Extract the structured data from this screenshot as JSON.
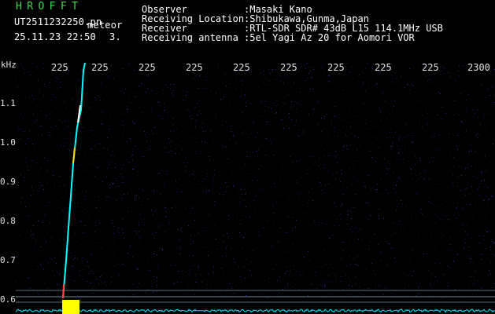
{
  "app_title": "HROFFT",
  "file_name": "UT2511232250.pn",
  "mode": "meteor",
  "timestamp": "25.11.23 22:50",
  "counter": "3.",
  "observer": {
    "label": "Observer",
    "value": ":Masaki Kano"
  },
  "location": {
    "label": "Receiving Location",
    "value": ":Shibukawa,Gunma,Japan"
  },
  "receiver": {
    "label": "Receiver",
    "value": ":RTL-SDR SDR# 43dB L15 114.1MHz USB"
  },
  "antenna": {
    "label": "Receiving antenna",
    "value": ":5el Yagi Az 20 for Aomori VOR"
  },
  "axis": {
    "unit": "kHz",
    "x_ticks": [
      "225",
      "225",
      "225",
      "225",
      "225",
      "225",
      "225",
      "225",
      "225",
      "2300"
    ],
    "y_ticks": [
      "1.1",
      "1.0",
      "0.9",
      "0.8",
      "0.7",
      "0.6"
    ]
  },
  "colors": {
    "title": "#3fd84a",
    "text": "#ffffff",
    "tick": "#e0e0e0",
    "background": "#000000",
    "noise": "#1a1a5e",
    "trace": "#00ffff",
    "spectrum": "#00e5ff",
    "peak": "#ffff00"
  },
  "chart_data": {
    "type": "heatmap",
    "xlabel": "",
    "ylabel": "kHz",
    "x_tick_labels": [
      "225",
      "225",
      "225",
      "225",
      "225",
      "225",
      "225",
      "225",
      "225",
      "2300"
    ],
    "y_ticks": [
      1.1,
      1.0,
      0.9,
      0.8,
      0.7,
      0.6
    ],
    "ylim": [
      0.58,
      1.2
    ],
    "trace": {
      "description": "meteor echo",
      "points": [
        [
          0,
          0.58
        ],
        [
          2,
          0.71
        ],
        [
          4,
          0.82
        ],
        [
          6,
          0.93
        ],
        [
          8,
          1.04
        ],
        [
          10,
          1.13
        ],
        [
          11,
          1.2
        ]
      ]
    },
    "grid": false
  }
}
